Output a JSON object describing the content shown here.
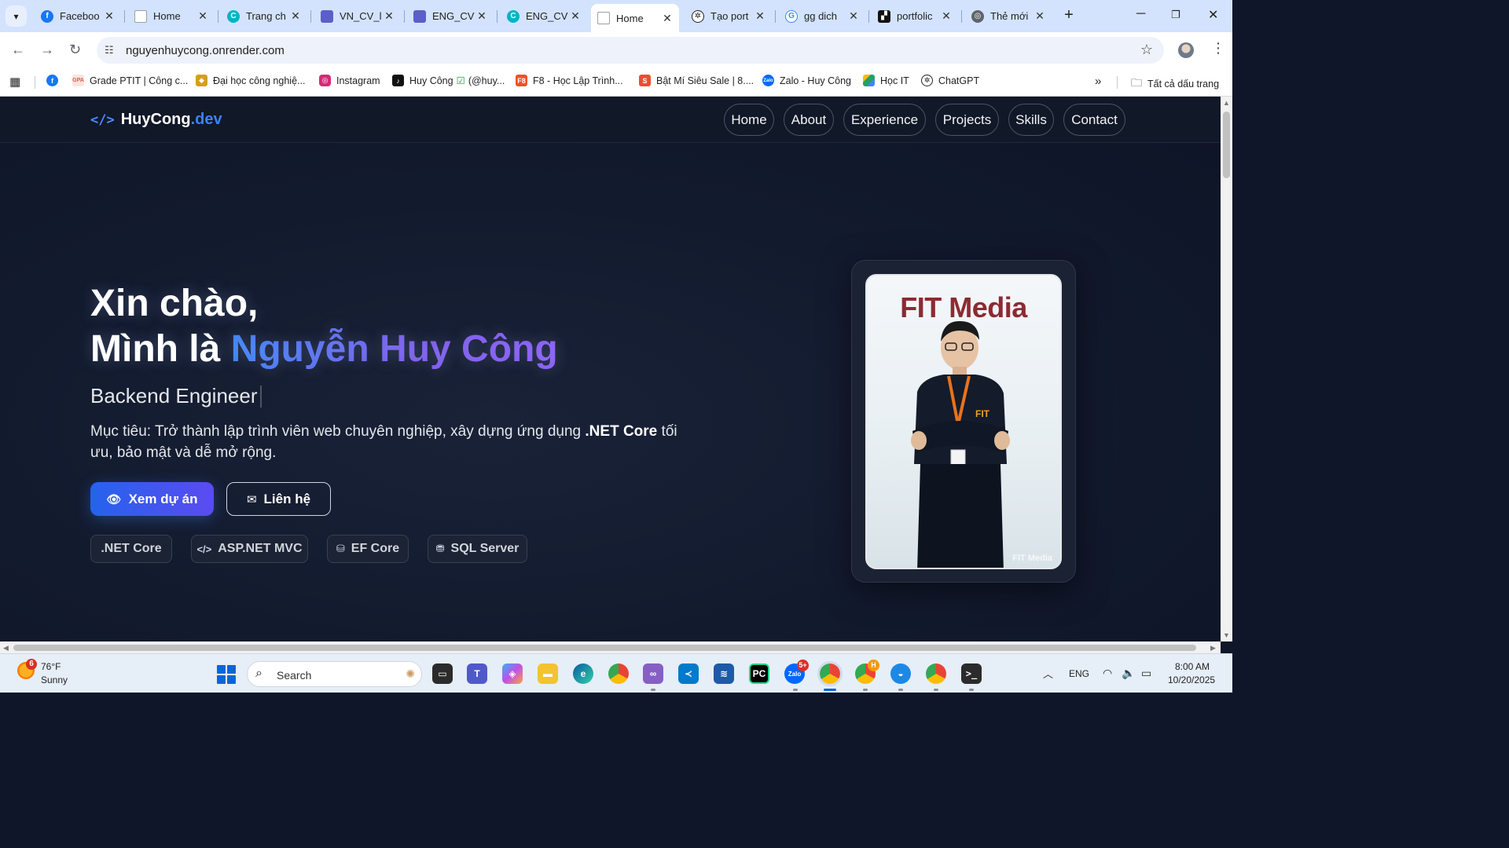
{
  "browser": {
    "tabs": [
      {
        "title": "Faceboo",
        "icon": "facebook-icon",
        "color": "#1877f2"
      },
      {
        "title": "Home",
        "icon": "page-icon",
        "color": "#9aa0a6"
      },
      {
        "title": "Trang ch",
        "icon": "canva-icon",
        "color": "#00b3c7"
      },
      {
        "title": "VN_CV_l",
        "icon": "doc-icon",
        "color": "#5b5fc7"
      },
      {
        "title": "ENG_CV",
        "icon": "doc-icon",
        "color": "#5b5fc7"
      },
      {
        "title": "ENG_CV",
        "icon": "canva-icon",
        "color": "#00b3c7"
      },
      {
        "title": "Home",
        "icon": "page-icon",
        "color": "#9aa0a6",
        "active": true
      },
      {
        "title": "Tạo port",
        "icon": "openai-icon",
        "color": "#222222"
      },
      {
        "title": "gg dich",
        "icon": "google-icon",
        "color": "#4285f4"
      },
      {
        "title": "portfolic",
        "icon": "paint-icon",
        "color": "#111111"
      },
      {
        "title": "Thẻ mới",
        "icon": "chrome-icon",
        "color": "#5f6368"
      }
    ],
    "url": "nguyenhuycong.onrender.com",
    "bookmarks": [
      {
        "label": "Grade PTIT | Công c...",
        "icon": "ptit-icon",
        "color": "#e05a47"
      },
      {
        "label": "Đại học công nghiệ...",
        "icon": "university-icon",
        "color": "#d4a017"
      },
      {
        "label": "Instagram",
        "icon": "instagram-icon",
        "color": "#d62976"
      },
      {
        "label": "Huy Công",
        "extra": "(@huy...",
        "icon": "tiktok-icon",
        "color": "#111111"
      },
      {
        "label": "F8 - Học Lập Trình...",
        "icon": "f8-icon",
        "color": "#f05123"
      },
      {
        "label": "Bật Mí Siêu Sale | 8....",
        "icon": "shopee-icon",
        "color": "#ee4d2d"
      },
      {
        "label": "Zalo - Huy Công",
        "icon": "zalo-icon",
        "color": "#0068ff"
      },
      {
        "label": "Học IT",
        "icon": "drive-icon",
        "color": "#1fa463"
      },
      {
        "label": "ChatGPT",
        "icon": "openai-icon",
        "color": "#222222"
      }
    ],
    "all_bookmarks_label": "Tất cả dấu trang"
  },
  "site": {
    "logo_main": "HuyCong",
    "logo_accent": ".dev",
    "nav": [
      "Home",
      "About",
      "Experience",
      "Projects",
      "Skills",
      "Contact"
    ],
    "hero": {
      "greeting": "Xin chào,",
      "intro_prefix": "Mình là",
      "name": "Nguyễn Huy Công",
      "role": "Backend Engineer",
      "desc_before": "Mục tiêu: Trở thành lập trình viên web chuyên nghiệp, xây dựng ứng dụng",
      "desc_bold": ".NET Core",
      "desc_after": "tối ưu, bảo mật và dễ mở rộng.",
      "primary_button": "Xem dự án",
      "secondary_button": "Liên hệ",
      "chips": [
        ".NET Core",
        "ASP.NET MVC",
        "EF Core",
        "SQL Server"
      ]
    },
    "photo": {
      "banner_text": "FIT Media",
      "watermark": "FIT Media"
    }
  },
  "taskbar": {
    "weather_badge": "6",
    "temperature": "76°F",
    "condition": "Sunny",
    "search_label": "Search",
    "zalo_badge": "5+",
    "chrome_badge": "H",
    "language": "ENG",
    "time": "8:00 AM",
    "date": "10/20/2025"
  },
  "colors": {
    "accent_blue": "#3b82f6",
    "accent_purple": "#8b5cf6",
    "page_bg": "#111827"
  }
}
